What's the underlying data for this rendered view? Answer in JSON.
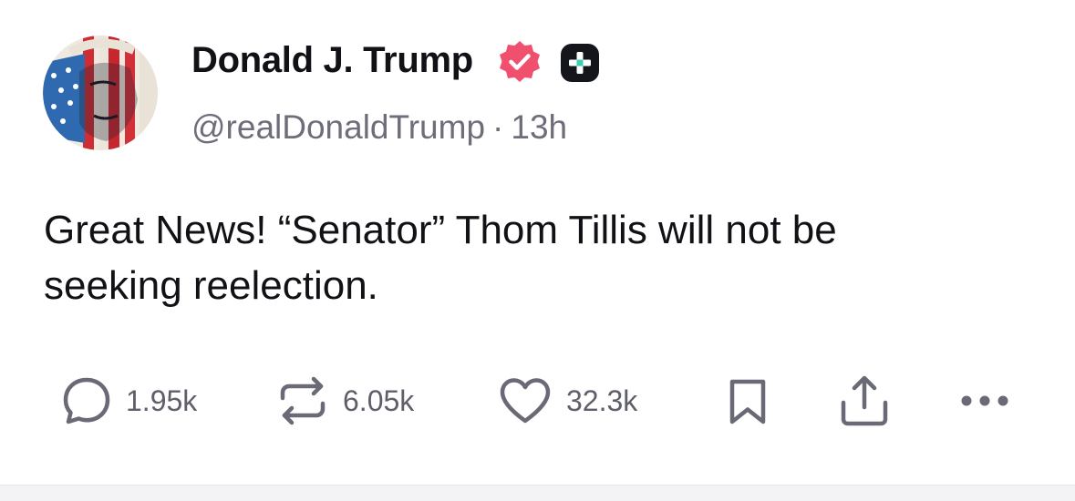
{
  "author": {
    "display_name": "Donald J. Trump",
    "handle": "@realDonaldTrump",
    "separator": "·",
    "time_ago": "13h",
    "avatar_icon": "flag-portrait-avatar",
    "verified_icon": "verified-badge-icon",
    "verified_color": "#f0506e",
    "plus_badge_icon": "plus-badge-icon"
  },
  "post": {
    "text": "Great News! “Senator” Thom Tillis will not be\nseeking reelection."
  },
  "actions": {
    "reply": {
      "icon": "speech-bubble-icon",
      "count": "1.95k"
    },
    "repost": {
      "icon": "repost-icon",
      "count": "6.05k"
    },
    "like": {
      "icon": "heart-icon",
      "count": "32.3k"
    },
    "bookmark": {
      "icon": "bookmark-icon"
    },
    "share": {
      "icon": "share-icon"
    },
    "more": {
      "icon": "more-dots-icon"
    }
  },
  "colors": {
    "text": "#111116",
    "secondary": "#6e6e7a",
    "icon": "#6a6a76"
  }
}
